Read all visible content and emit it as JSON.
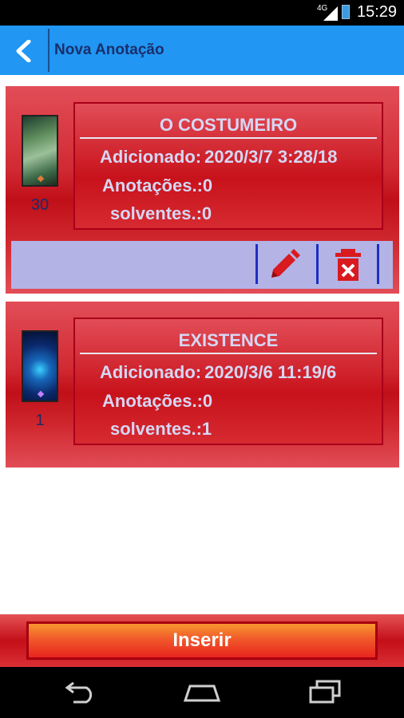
{
  "status_bar": {
    "network": "4G",
    "time": "15:29"
  },
  "action_bar": {
    "title": "Nova Anotação"
  },
  "cards": [
    {
      "count": "30",
      "title": "O COSTUMEIRO",
      "added_label": "Adicionado:",
      "added_value": "2020/3/7 3:28/18",
      "notes": "Anotações.:0",
      "solved": "solventes.:0"
    },
    {
      "count": "1",
      "title": "EXISTENCE",
      "added_label": "Adicionado:",
      "added_value": "2020/3/6 11:19/6",
      "notes": "Anotações.:0",
      "solved": "solventes.:1"
    }
  ],
  "actions": {
    "edit_icon": "pencil-icon",
    "delete_icon": "trash-icon"
  },
  "bottom": {
    "insert_label": "Inserir"
  },
  "colors": {
    "action_bar": "#2196f3",
    "card_red": "#c00f18",
    "text_lavender": "#d5d7f4",
    "strip": "#b3b3e6"
  }
}
